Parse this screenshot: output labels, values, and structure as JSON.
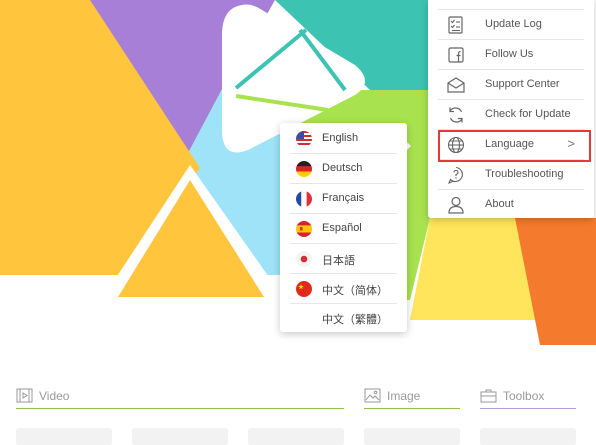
{
  "menu": {
    "items": [
      {
        "label": "",
        "icon": "document-icon"
      },
      {
        "label": "Update Log",
        "icon": "checklist-icon"
      },
      {
        "label": "Follow Us",
        "icon": "facebook-icon"
      },
      {
        "label": "Support Center",
        "icon": "envelope-icon"
      },
      {
        "label": "Check for Update",
        "icon": "refresh-icon"
      },
      {
        "label": "Language",
        "icon": "globe-icon",
        "arrow": ">"
      },
      {
        "label": "Troubleshooting",
        "icon": "help-bubble-icon"
      },
      {
        "label": "About",
        "icon": "user-icon"
      }
    ],
    "highlight_color": "#e53935"
  },
  "language_menu": {
    "items": [
      {
        "label": "English",
        "flag": "us-flag-icon"
      },
      {
        "label": "Deutsch",
        "flag": "germany-flag-icon"
      },
      {
        "label": "Français",
        "flag": "france-flag-icon"
      },
      {
        "label": "Español",
        "flag": "spain-flag-icon"
      },
      {
        "label": "日本語",
        "flag": "japan-flag-icon"
      },
      {
        "label": "中文（简体）",
        "flag": "china-flag-icon"
      },
      {
        "label": "中文（繁體）",
        "flag": ""
      }
    ]
  },
  "tabs": [
    {
      "label": "Video",
      "icon": "film-icon",
      "color": "#8bc34a"
    },
    {
      "label": "Image",
      "icon": "image-icon",
      "color": "#8bc34a"
    },
    {
      "label": "Toolbox",
      "icon": "toolbox-icon",
      "color": "#b39ddb"
    }
  ],
  "colors": {
    "purple": "#a77fd6",
    "yellow": "#ffc53d",
    "teal": "#3cc3b2",
    "light_blue": "#9ee3f7",
    "green": "#a8e24e",
    "orange": "#f47b2e",
    "light_yellow": "#ffe55c"
  }
}
